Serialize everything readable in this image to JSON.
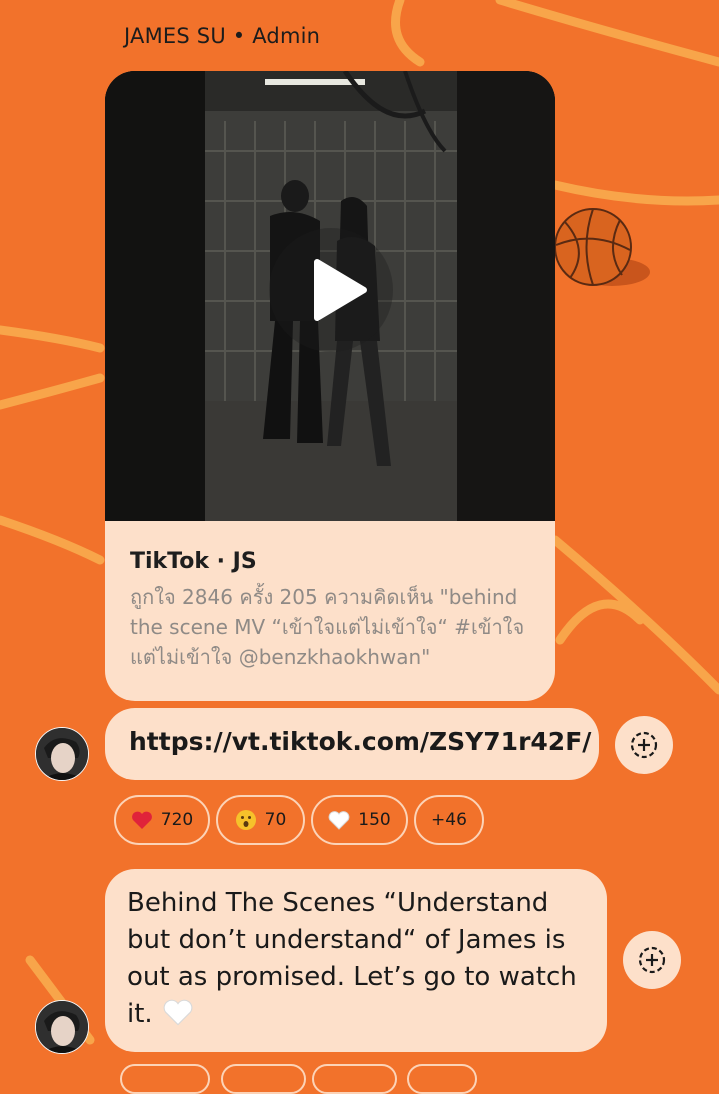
{
  "message_group": {
    "sender_name": "JAMES SU",
    "sender_role": "Admin",
    "separator": " • "
  },
  "link_card": {
    "title": "TikTok · JS",
    "description": "ถูกใจ 2846 ครั้ง 205 ความคิดเห็น \"behind the scene MV “เข้าใจแต่ไม่เข้าใจ“ #เข้าใจแต่ไม่เข้าใจ @benzkhaokhwan\"",
    "video": {
      "playing": false,
      "play_icon": "play-icon"
    }
  },
  "link_message": {
    "url": "https://vt.tiktok.com/ZSY71r42F/",
    "share_icon": "share-icon"
  },
  "reactions": [
    {
      "emoji": "heart-red-icon",
      "count": "720"
    },
    {
      "emoji": "surprised-face-icon",
      "count": "70"
    },
    {
      "emoji": "heart-white-icon",
      "count": "150"
    },
    {
      "emoji": "",
      "count": "+46"
    }
  ],
  "text_message": {
    "text": "Behind The Scenes “Understand but don’t understand“ of James is out as promised. Let’s go to watch it.",
    "emoji": "white-heart-icon",
    "share_icon": "share-icon"
  },
  "colors": {
    "background": "#f2722b",
    "bubble": "#fde0ca",
    "doodle": "#f8a54a",
    "secondary_text": "#8f8a86"
  }
}
